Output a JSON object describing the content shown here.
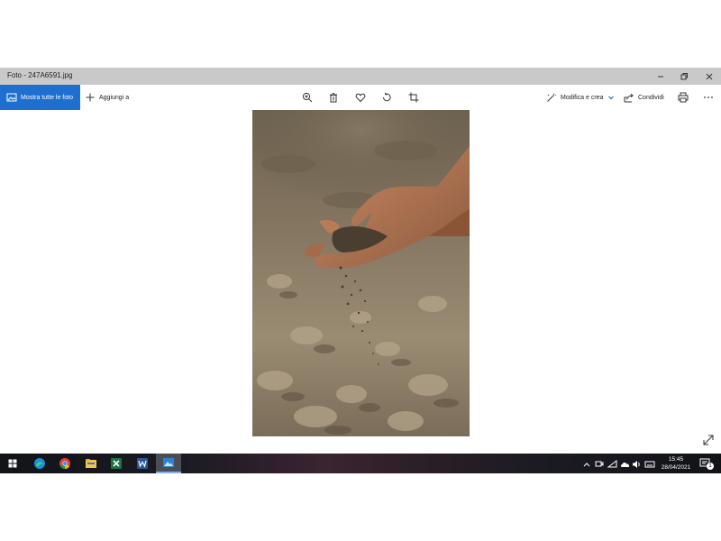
{
  "window": {
    "title": "Foto - 247A6591.jpg"
  },
  "toolbar": {
    "show_all_label": "Mostra tutte le foto",
    "add_to_label": "Aggiungi a",
    "edit_create_label": "Modifica e crea",
    "share_label": "Condividi"
  },
  "photo": {
    "subject": "hand letting soil fall onto dry ground"
  },
  "taskbar": {
    "apps": [
      "windows-start-icon",
      "edge-icon",
      "chrome-icon",
      "file-explorer-icon",
      "excel-icon",
      "word-icon",
      "photos-icon"
    ],
    "time": "15:45",
    "date": "28/04/2021",
    "notification_count": "1"
  },
  "colors": {
    "accent": "#1e6fd0",
    "titlebar": "#c9c9c9",
    "taskbar": "#16171c"
  }
}
